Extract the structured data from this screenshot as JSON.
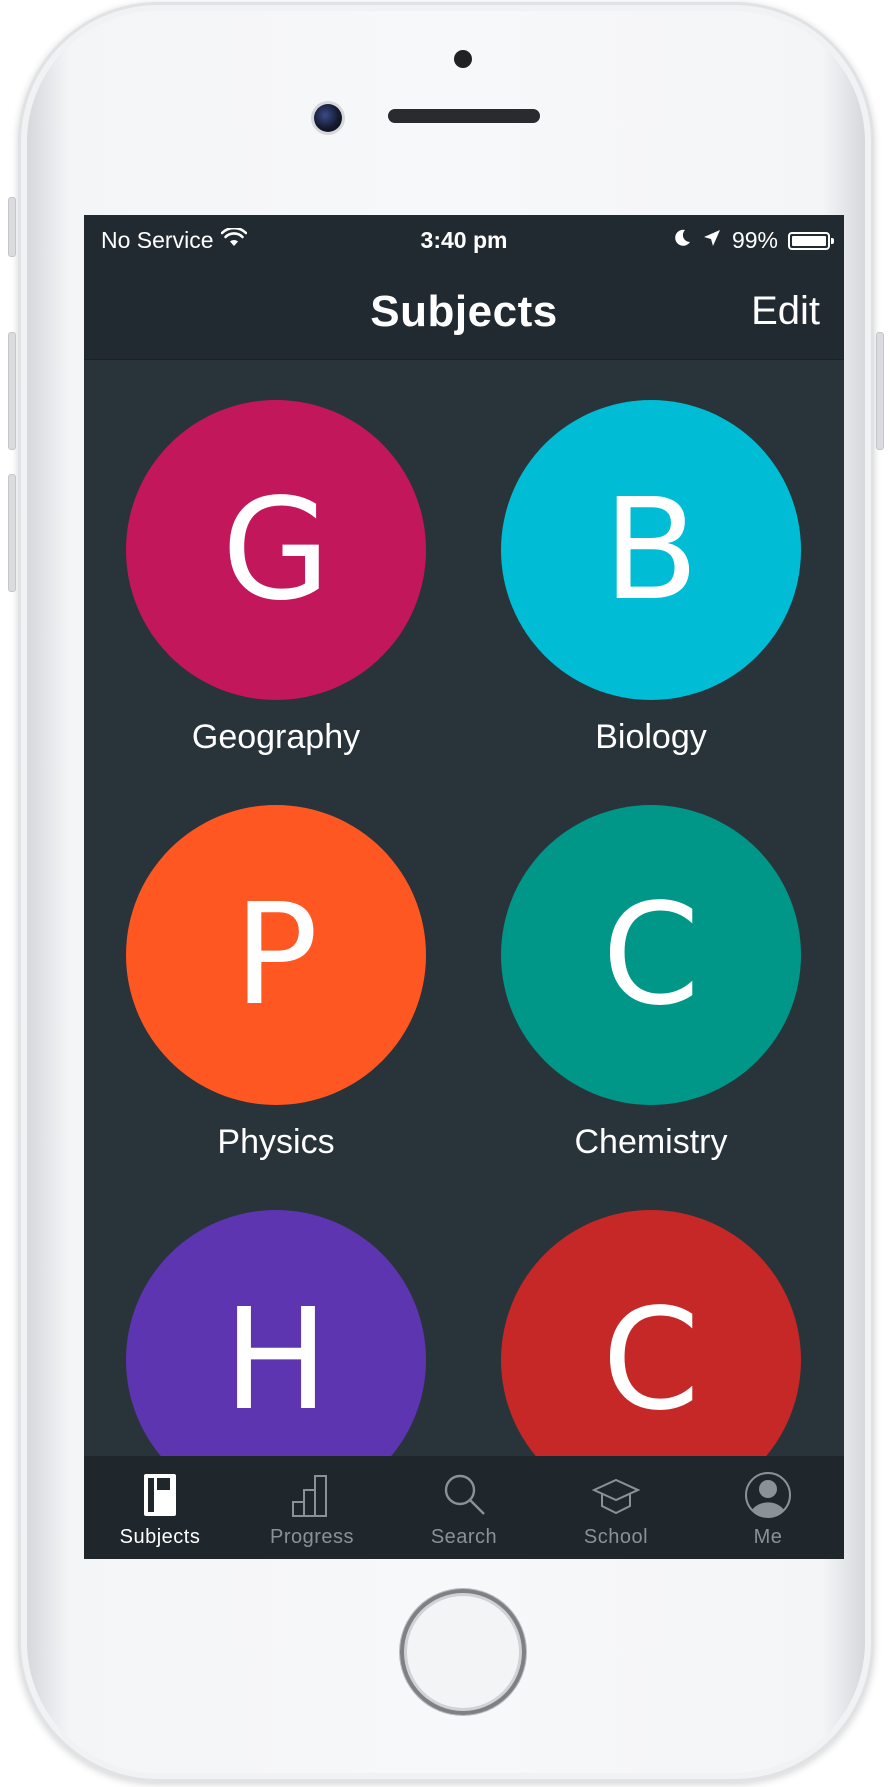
{
  "status_bar": {
    "carrier": "No Service",
    "time": "3:40 pm",
    "battery": "99%",
    "battery_level": 0.99
  },
  "nav": {
    "title": "Subjects",
    "edit_label": "Edit"
  },
  "subjects": [
    {
      "letter": "G",
      "name": "Geography",
      "color": "#c2185b"
    },
    {
      "letter": "B",
      "name": "Biology",
      "color": "#00bcd4"
    },
    {
      "letter": "P",
      "name": "Physics",
      "color": "#ff5722"
    },
    {
      "letter": "C",
      "name": "Chemistry",
      "color": "#009688"
    },
    {
      "letter": "H",
      "name": "",
      "color": "#5e35b1"
    },
    {
      "letter": "C",
      "name": "",
      "color": "#c62828"
    }
  ],
  "tabs": [
    {
      "label": "Subjects",
      "icon": "notebook-icon",
      "active": true
    },
    {
      "label": "Progress",
      "icon": "bar-chart-icon",
      "active": false
    },
    {
      "label": "Search",
      "icon": "search-icon",
      "active": false
    },
    {
      "label": "School",
      "icon": "graduation-cap-icon",
      "active": false
    },
    {
      "label": "Me",
      "icon": "user-avatar-icon",
      "active": false
    }
  ],
  "colors": {
    "background": "#29333a",
    "bars": "#212a30",
    "tab_inactive": "#8a9197"
  }
}
